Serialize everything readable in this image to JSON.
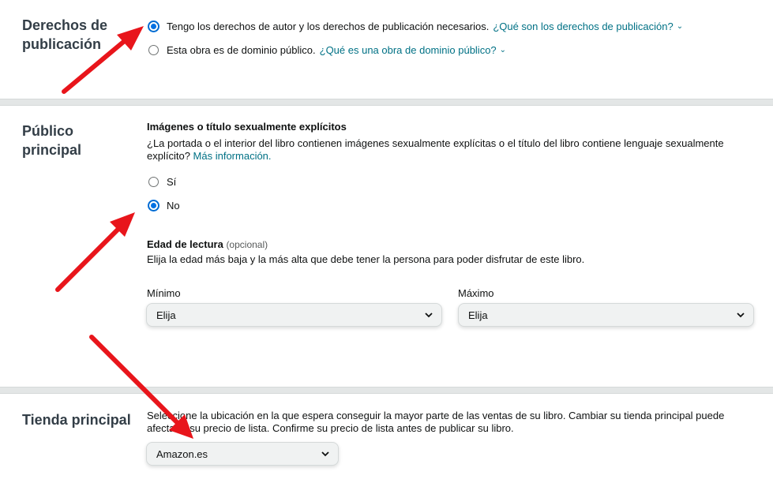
{
  "rights": {
    "title_line1": "Derechos de",
    "title_line2": "publicación",
    "option1_label": "Tengo los derechos de autor y los derechos de publicación necesarios.",
    "option1_link": "¿Qué son los derechos de publicación?",
    "option2_label": "Esta obra es de dominio público.",
    "option2_link": "¿Qué es una obra de dominio público?",
    "selected": "option1"
  },
  "audience": {
    "title_line1": "Público",
    "title_line2": "principal",
    "explicit_heading": "Imágenes o título sexualmente explícitos",
    "explicit_question_line1": "¿La portada o el interior del libro contienen imágenes sexualmente explícitas o el título del libro contiene lenguaje sexualmente",
    "explicit_question_line2": "explícito?",
    "more_info_link": "Más información.",
    "yes_label": "Sí",
    "no_label": "No",
    "selected": "no",
    "age_heading": "Edad de lectura",
    "age_optional": "(opcional)",
    "age_description": "Elija la edad más baja y la más alta que debe tener la persona para poder disfrutar de este libro.",
    "min_label": "Mínimo",
    "max_label": "Máximo",
    "min_value": "Elija",
    "max_value": "Elija"
  },
  "store": {
    "title": "Tienda principal",
    "description_line1": "Seleccione la ubicación en la que espera conseguir la mayor parte de las ventas de su libro. Cambiar su tienda principal puede",
    "description_line2": "afectar a su precio de lista. Confirme su precio de lista antes de publicar su libro.",
    "value": "Amazon.es"
  },
  "colors": {
    "link": "#007185",
    "radio_selected": "#0071e3",
    "annotation_arrow": "#e8151b",
    "section_divider": "#e3e6e6"
  }
}
